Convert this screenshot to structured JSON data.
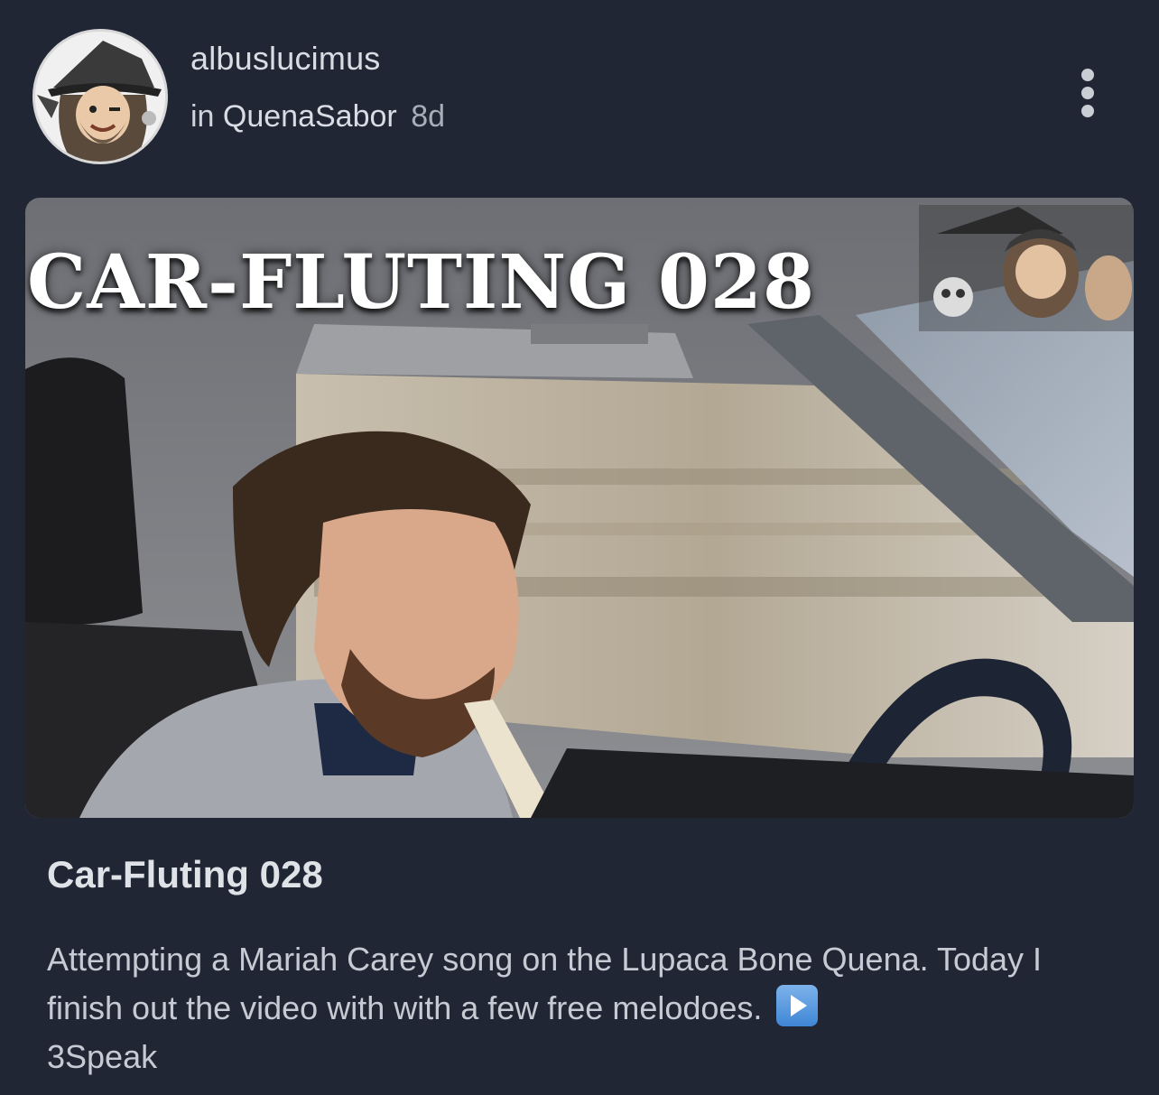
{
  "post": {
    "author": "albuslucimus",
    "community_prefix": "in",
    "community": "QuenaSabor",
    "age": "8d",
    "thumbnail_text": "CAR-FLUTING 028",
    "title": "Car-Fluting 028",
    "body_text": "Attempting a Mariah Carey song on the Lupaca Bone Quena. Today I finish out the video with with a few free melodoes.",
    "body_emoji": "play-button-icon",
    "body_suffix": "3Speak"
  },
  "icons": {
    "avatar": "wizard-avatar",
    "more": "more-vertical-icon"
  },
  "colors": {
    "background": "#202634",
    "text_primary": "#dfe3e8",
    "text_secondary": "#a8aeb8",
    "play_emoji": "#3f86d6"
  }
}
